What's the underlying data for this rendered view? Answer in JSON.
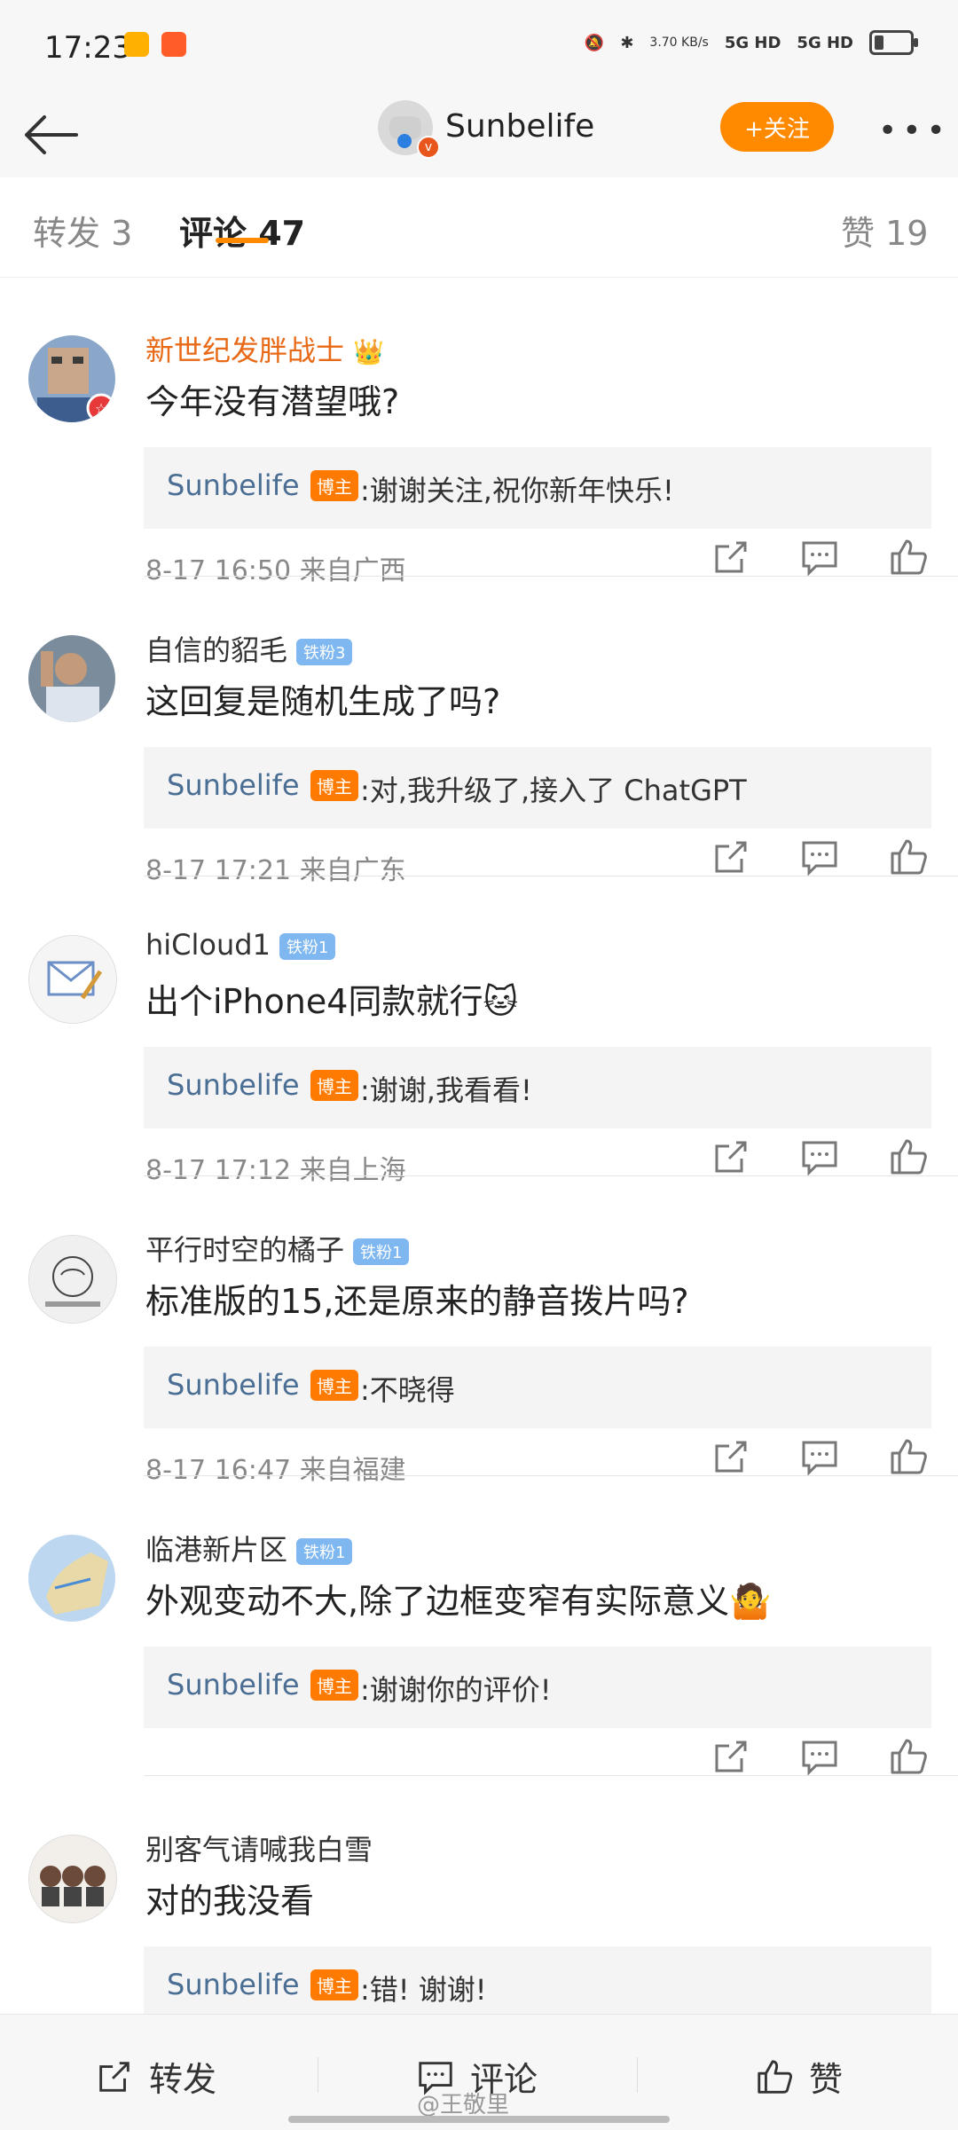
{
  "status": {
    "time": "17:23",
    "net_speed": "3.70\nKB/s",
    "signal1": "5G HD",
    "signal2": "5G HD"
  },
  "topbar": {
    "name": "Sunbelife",
    "follow_label": "+关注",
    "more_label": "•••"
  },
  "tabs": [
    {
      "label": "转发 3"
    },
    {
      "label": "评论 47"
    },
    {
      "label": "赞 19"
    }
  ],
  "comments": [
    {
      "name": "新世纪发胖战士",
      "text": "今年没有潜望哦?",
      "reply_name": "Sunbelife",
      "reply_tag": "博主",
      "reply_text": ":谢谢关注,祝你新年快乐!",
      "meta": "8-17 16:50  来自广西"
    },
    {
      "name": "自信的貂毛",
      "fan": "铁粉3",
      "text": "这回复是随机生成了吗?",
      "reply_name": "Sunbelife",
      "reply_tag": "博主",
      "reply_text": ":对,我升级了,接入了 ChatGPT",
      "meta": "8-17 17:21  来自广东"
    },
    {
      "name": "hiCloud1",
      "fan": "铁粉1",
      "text": "出个iPhone4同款就行🐱",
      "reply_name": "Sunbelife",
      "reply_tag": "博主",
      "reply_text": ":谢谢,我看看!",
      "meta": "8-17 17:12  来自上海"
    },
    {
      "name": "平行时空的橘子",
      "fan": "铁粉1",
      "text": "标准版的15,还是原来的静音拨片吗?",
      "reply_name": "Sunbelife",
      "reply_tag": "博主",
      "reply_text": ":不晓得",
      "meta": "8-17 16:47  来自福建"
    },
    {
      "name": "临港新片区",
      "fan": "铁粉1",
      "text": "外观变动不大,除了边框变窄有实际意义🤷",
      "reply_name": "Sunbelife",
      "reply_tag": "博主",
      "reply_text": ":谢谢你的评价!",
      "meta": ""
    },
    {
      "name": "别客气请喊我白雪",
      "text": "对的我没看",
      "reply_name": "Sunbelife",
      "reply_tag": "博主",
      "reply_text": ":错!  谢谢!",
      "meta": ""
    }
  ],
  "bottombar": {
    "repost": "转发",
    "comment": "评论",
    "like": "赞"
  },
  "watermark": "@王敬里",
  "colors": {
    "accent": "#ff8a00",
    "reply_name": "#4a6e94",
    "vip_name": "#e86a16",
    "fan_badge": "#7fb7f0"
  }
}
